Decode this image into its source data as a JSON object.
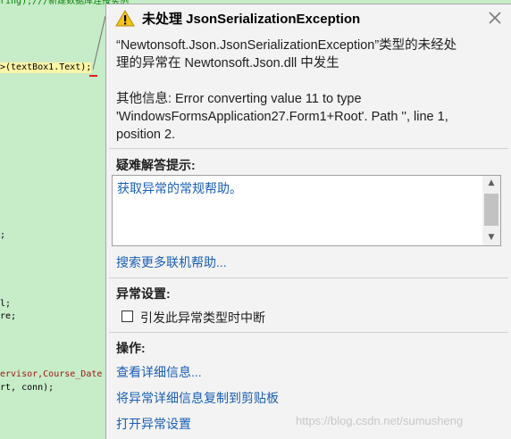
{
  "editor": {
    "lines": [
      {
        "text": "ring);///新建数据库连接实例",
        "cls": "code-comment"
      },
      {
        "text": ">(textBox1.Text);",
        "cls": "code-hl"
      },
      {
        "text": ";",
        "cls": ""
      },
      {
        "text": "l;",
        "cls": ""
      },
      {
        "text": "re;",
        "cls": ""
      },
      {
        "text": "ervisor,Course_Date",
        "cls": "code-red"
      },
      {
        "text": "rt, conn);",
        "cls": ""
      }
    ]
  },
  "exception": {
    "title": "未处理 JsonSerializationException",
    "message_line1": "“Newtonsoft.Json.JsonSerializationException”类型的未经处",
    "message_line2": "理的异常在 Newtonsoft.Json.dll 中发生",
    "info_line1": "其他信息: Error converting value 11 to type",
    "info_line2": "'WindowsFormsApplication27.Form1+Root'. Path '', line 1,",
    "info_line3": "position 2.",
    "tips_heading": "疑难解答提示:",
    "tips_item": "获取异常的常规帮助。",
    "search_link": "搜索更多联机帮助...",
    "settings_heading": "异常设置:",
    "break_checkbox_label": "引发此异常类型时中断",
    "break_checkbox_checked": false,
    "actions_heading": "操作:",
    "action_view_details": "查看详细信息...",
    "action_copy_details": "将异常详细信息复制到剪贴板",
    "action_open_settings": "打开异常设置"
  },
  "watermark": "https://blog.csdn.net/sumusheng",
  "colors": {
    "editor_bg": "#c7ecc8",
    "popup_bg": "#f3f3f3",
    "link": "#1a5fb4",
    "warning_icon": "#f5c518"
  },
  "icons": {
    "warning": "warning-icon",
    "close": "close-icon",
    "scroll_up": "chevron-up-icon",
    "scroll_down": "chevron-down-icon"
  }
}
